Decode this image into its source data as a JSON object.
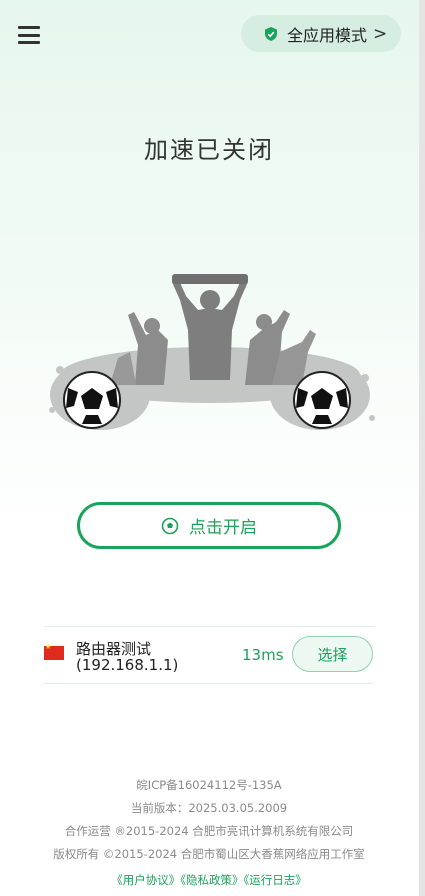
{
  "header": {
    "menu_icon": "hamburger-menu-icon",
    "mode_icon": "shield-icon",
    "mode_label": "全应用模式",
    "mode_chevron": "›"
  },
  "status": {
    "title": "加速已关闭"
  },
  "start_button": {
    "icon": "soccer-ball-icon",
    "label": "点击开启"
  },
  "node": {
    "flag": "china-flag",
    "name": "路由器测试",
    "ip": "(192.168.1.1)",
    "latency": "13ms",
    "select_label": "选择"
  },
  "footer": {
    "icp": "皖ICP备16024112号-135A",
    "version": "当前版本：2025.03.05.2009",
    "operator": "合作运营 ®2015-2024 合肥市亮讯计算机系统有限公司",
    "copyright": "版权所有 ©2015-2024 合肥市蜀山区大香蕉网络应用工作室",
    "links": [
      "《用户协议》",
      "《隐私政策》",
      "《运行日志》"
    ]
  },
  "colors": {
    "accent": "#1aa35a",
    "background_top": "#e6f7ee",
    "footer_text": "#8a8a8a"
  }
}
